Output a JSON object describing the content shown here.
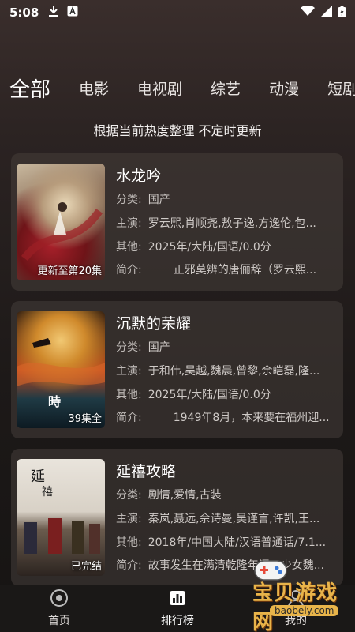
{
  "status_bar": {
    "time": "5:08",
    "icons_left": [
      "download-icon",
      "a-icon"
    ],
    "icons_right": [
      "wifi-icon",
      "signal-icon",
      "battery-icon"
    ]
  },
  "tabs": [
    {
      "label": "全部",
      "active": true
    },
    {
      "label": "电影",
      "active": false
    },
    {
      "label": "电视剧",
      "active": false
    },
    {
      "label": "综艺",
      "active": false
    },
    {
      "label": "动漫",
      "active": false
    },
    {
      "label": "短剧",
      "active": false
    }
  ],
  "notice": "根据当前热度整理 不定时更新",
  "labels": {
    "category": "分类:",
    "cast": "主演:",
    "other": "其他:",
    "synopsis": "简介:"
  },
  "cards": [
    {
      "title": "水龙吟",
      "category": "国产",
      "cast": "罗云熙,肖顺尧,敖子逸,方逸伦,包...",
      "other": "2025年/大陆/国语/0.0分",
      "synopsis": "正邪莫辨的唐俪辞（罗云熙...",
      "badge": "更新至第20集"
    },
    {
      "title": "沉默的荣耀",
      "category": "国产",
      "cast": "于和伟,吴越,魏晨,曾黎,余皑磊,隆...",
      "other": "2025年/大陆/国语/0.0分",
      "synopsis": "1949年8月，本来要在福州迎...",
      "badge": "39集全"
    },
    {
      "title": "延禧攻略",
      "category": "剧情,爱情,古装",
      "cast": "秦岚,聂远,佘诗曼,吴谨言,许凯,王...",
      "other": "2018年/中国大陆/汉语普通话/7.1...",
      "synopsis": "故事发生在满清乾隆年间，少女魏...",
      "badge": "已完结"
    }
  ],
  "bottom_nav": [
    {
      "label": "首页",
      "icon": "home-icon",
      "active": false
    },
    {
      "label": "排行榜",
      "icon": "ranking-icon",
      "active": true
    },
    {
      "label": "我的",
      "icon": "profile-icon",
      "active": false
    }
  ],
  "watermark": {
    "text": "宝贝游戏网",
    "sub": "baobeiy.com"
  }
}
